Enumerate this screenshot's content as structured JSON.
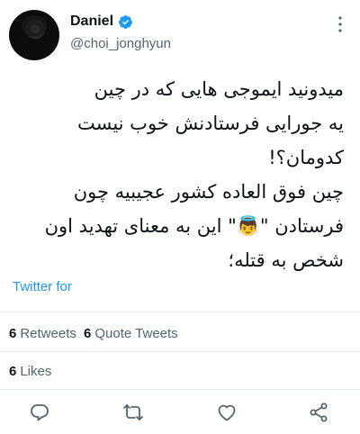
{
  "tweet": {
    "display_name": "Daniel",
    "username": "@choi_jonghyun",
    "verified": true,
    "text_lines": [
      "میدونید ایموجی هایی که در چین",
      "یه جورایی فرستادنش خوب نیست",
      "کدومان؟!",
      "چین فوق العاده کشور عجیبیه چون",
      "فرستادن \"👼\" این به معنای تهدید اون",
      "شخص به قتله؛"
    ],
    "source": "Twitter for"
  },
  "stats": {
    "retweets_count": "6",
    "retweets_label": "Retweets",
    "quote_count": "6",
    "quote_label": "Quote Tweets",
    "likes_count": "6",
    "likes_label": "Likes"
  },
  "colors": {
    "accent": "#1d9bf0",
    "text": "#0f1419",
    "secondary": "#536471",
    "divider": "#e6ecf0"
  },
  "icons": {
    "verified": "verified-badge-icon",
    "more": "more-vertical-icon",
    "reply": "reply-icon",
    "retweet": "retweet-icon",
    "like": "heart-icon",
    "share": "share-icon"
  }
}
